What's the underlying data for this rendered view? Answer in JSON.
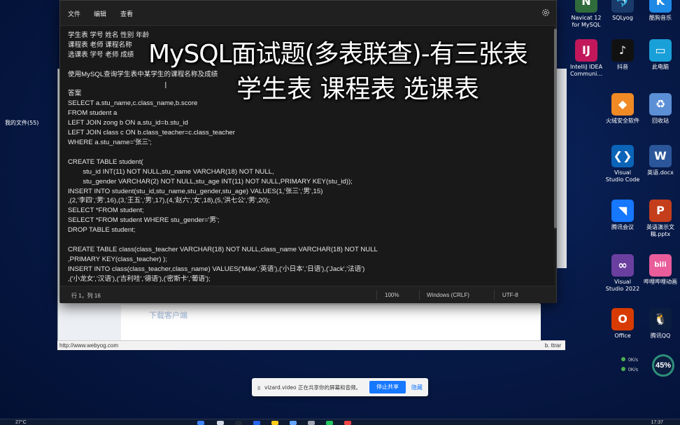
{
  "notepad": {
    "menu": [
      "文件",
      "编辑",
      "查看"
    ],
    "code_lines": [
      "学生表 学号 姓名 性别 年龄",
      "课程表 老师 课程名称",
      "选课表 学号 老师 成绩",
      "",
      "使用MySQL查询学生表中某学生的课程名称及成绩",
      "",
      "答案",
      "SELECT a.stu_name,c.class_name,b.score",
      "FROM student a",
      "LEFT JOIN zong b ON a.stu_id=b.stu_id",
      "LEFT JOIN class c ON b.class_teacher=c.class_teacher",
      "WHERE a.stu_name='张三';",
      "",
      "CREATE TABLE student(",
      "        stu_id INT(11) NOT NULL,stu_name VARCHAR(18) NOT NULL,",
      "        stu_gender VARCHAR(2) NOT NULL,stu_age INT(11) NOT NULL,PRIMARY KEY(stu_id));",
      "INSERT INTO student(stu_id,stu_name,stu_gender,stu_age) VALUES(1,'张三','男',15)",
      ",(2,'李四','男',16),(3,'王五','男',17),(4,'赵六','女',18),(5,'洪七公','男',20);",
      "SELECT *FROM student;",
      "SELECT *FROM student WHERE stu_gender='男';",
      "DROP TABLE student;",
      "",
      "CREATE TABLE class(class_teacher VARCHAR(18) NOT NULL,class_name VARCHAR(18) NOT NULL",
      ",PRIMARY KEY(class_teacher) );",
      "INSERT INTO class(class_teacher,class_name) VALUES('Mike','英语'),('小日本','日语'),('Jack','法语')",
      ",('小龙女','汉语'),('吉利哇','德语'),('密斯卡','葡语');"
    ],
    "status": {
      "position": "行 1，列 16",
      "zoom": "100%",
      "line_ending": "Windows (CRLF)",
      "encoding": "UTF-8"
    }
  },
  "overlay": {
    "line1": "MySQL面试题(多表联查)-有三张表",
    "line2": "学生表 课程表 选课表"
  },
  "background_window": {
    "download_text": "下载客户端",
    "url": "http://www.webyog.com",
    "right_text": "b. ttrar"
  },
  "left_label": "我的文件(55)",
  "desktop_icons": [
    {
      "label": "Navicat 12\nfor MySQL",
      "glyph": "N",
      "color": "#2f6b3b"
    },
    {
      "label": "SQLyog",
      "glyph": "🐬",
      "color": "#1a3a6a"
    },
    {
      "label": "酷狗音乐",
      "glyph": "K",
      "color": "#1e88e5"
    },
    {
      "label": "IntelliJ IDEA\nCommuni...",
      "glyph": "IJ",
      "color": "#c2185b"
    },
    {
      "label": "抖音",
      "glyph": "♪",
      "color": "#111111"
    },
    {
      "label": "此电脑",
      "glyph": "▭",
      "color": "#1aa0d8"
    },
    {
      "label": "火绒安全软件",
      "glyph": "◆",
      "color": "#f08a24"
    },
    {
      "label": "回收站",
      "glyph": "♻",
      "color": "#5b8fd6"
    },
    {
      "label": "Visual\nStudio Code",
      "glyph": "❮❯",
      "color": "#0a64b8"
    },
    {
      "label": "英语.docx",
      "glyph": "W",
      "color": "#2b579a"
    },
    {
      "label": "腾讯会议",
      "glyph": "◥",
      "color": "#1677ff"
    },
    {
      "label": "英语演示文\n稿.pptx",
      "glyph": "P",
      "color": "#c43e1c"
    },
    {
      "label": "Visual\nStudio 2022",
      "glyph": "∞",
      "color": "#6b3fa0"
    },
    {
      "label": "哔哩哔哩动画",
      "glyph": "bili",
      "color": "#e85d9a"
    },
    {
      "label": "Office",
      "glyph": "O",
      "color": "#d83b01"
    },
    {
      "label": "腾讯QQ",
      "glyph": "🐧",
      "color": "#0b1e3f"
    }
  ],
  "perf": {
    "percent": "45%",
    "up": "0K/s",
    "down": "0K/s"
  },
  "sharebar": {
    "message": "vizard.video 正在共享你的屏幕和音频。",
    "stop": "停止共享",
    "hide": "隐藏"
  },
  "taskbar": {
    "weather": "27°C",
    "clock": "17:37"
  }
}
